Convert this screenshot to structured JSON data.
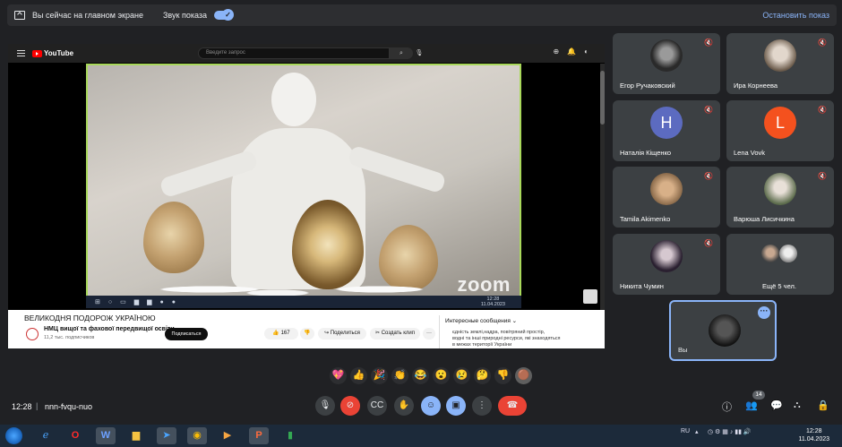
{
  "topbar": {
    "presenting_text": "Вы сейчас на главном экране",
    "sound_label": "Звук показа",
    "stop_label": "Остановить показ"
  },
  "youtube": {
    "logo_text": "YouTube",
    "search_placeholder": "Введите запрос",
    "video_title": "ВЕЛИКОДНЯ ПОДОРОЖ УКРАЇНОЮ",
    "channel_name": "НМЦ вищої та фахової передвищої освіти",
    "channel_subs": "11,2 тыс. подписчиков",
    "subscribe_label": "Подписаться",
    "likes": "167",
    "share_label": "Поделиться",
    "clip_label": "Создать клип",
    "more_label": "···",
    "side_header": "Интересные сообщения",
    "side_text": [
      "єдність землі,надра, повітряний простір,",
      "водні та інші природні ресурси, які знаходяться",
      "в межах території України"
    ],
    "zoom_watermark": "zoom",
    "zoom_time_1": "12:28",
    "zoom_time_2": "11.04.2023"
  },
  "participants": [
    {
      "name": "Егор Ручаковский",
      "type": "photo",
      "style": "av-photo1"
    },
    {
      "name": "Ира Корнеева",
      "type": "photo",
      "style": "av-photo2"
    },
    {
      "name": "Наталія Кіщенко",
      "type": "letter",
      "letter": "H",
      "color": "#5c6bc0"
    },
    {
      "name": "Lena Vovk",
      "type": "letter",
      "letter": "L",
      "color": "#f4511e"
    },
    {
      "name": "Tamila Akimenko",
      "type": "photo",
      "style": "av-photo3"
    },
    {
      "name": "Варюша Лисичкина",
      "type": "photo",
      "style": "av-photo4"
    },
    {
      "name": "Никита Чумин",
      "type": "photo",
      "style": "av-photo5"
    }
  ],
  "more_tile": {
    "label": "Ещё 5 чел."
  },
  "you_tile": {
    "label": "Вы"
  },
  "reactions": [
    "💖",
    "👍",
    "🎉",
    "👏",
    "😂",
    "😮",
    "😢",
    "🤔",
    "👎",
    "🟤"
  ],
  "bottom": {
    "time": "12:28",
    "separator": "|",
    "meeting_code": "nnn-fvqu-nuo",
    "people_count": "14"
  },
  "taskbar": {
    "lang": "RU",
    "time": "12:28",
    "date": "11.04.2023"
  },
  "colors": {
    "accent": "#8ab4f8",
    "danger": "#ea4335",
    "tile": "#3c4043",
    "background": "#202124"
  }
}
